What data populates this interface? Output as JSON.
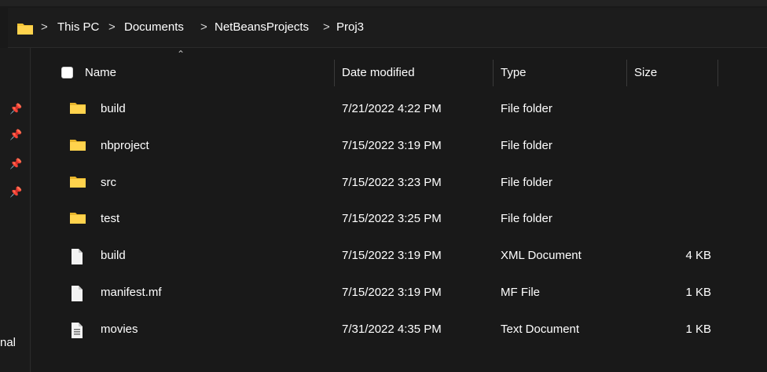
{
  "breadcrumb": {
    "items": [
      "This PC",
      "Documents",
      "NetBeansProjects",
      "Proj3"
    ],
    "separator": ">"
  },
  "columns": {
    "name": "Name",
    "date": "Date modified",
    "type": "Type",
    "size": "Size"
  },
  "files": [
    {
      "name": "build",
      "date": "7/21/2022 4:22 PM",
      "type": "File folder",
      "size": "",
      "icon": "folder-icon"
    },
    {
      "name": "nbproject",
      "date": "7/15/2022 3:19 PM",
      "type": "File folder",
      "size": "",
      "icon": "folder-icon"
    },
    {
      "name": "src",
      "date": "7/15/2022 3:23 PM",
      "type": "File folder",
      "size": "",
      "icon": "folder-icon"
    },
    {
      "name": "test",
      "date": "7/15/2022 3:25 PM",
      "type": "File folder",
      "size": "",
      "icon": "folder-icon"
    },
    {
      "name": "build",
      "date": "7/15/2022 3:19 PM",
      "type": "XML Document",
      "size": "4 KB",
      "icon": "file-icon"
    },
    {
      "name": "manifest.mf",
      "date": "7/15/2022 3:19 PM",
      "type": "MF File",
      "size": "1 KB",
      "icon": "file-icon"
    },
    {
      "name": "movies",
      "date": "7/31/2022 4:35 PM",
      "type": "Text Document",
      "size": "1 KB",
      "icon": "text-file-icon"
    }
  ],
  "sidebar": {
    "label_fragment": "nal"
  },
  "colors": {
    "background": "#191919",
    "folder": "#f2c335",
    "text": "#ffffff"
  }
}
